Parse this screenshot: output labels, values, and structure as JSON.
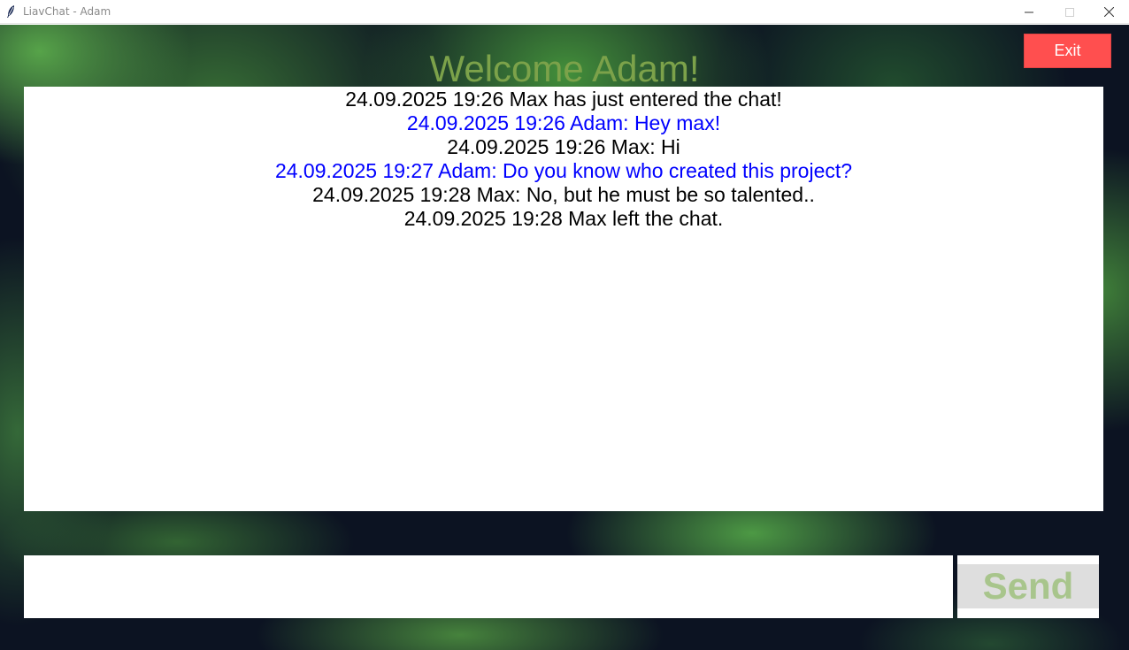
{
  "window": {
    "title": "LiavChat - Adam",
    "icon": "feather-icon",
    "controls": [
      "minimize-icon",
      "maximize-icon",
      "close-icon"
    ]
  },
  "header": {
    "welcome_text": "Welcome Adam!",
    "exit_label": "Exit"
  },
  "chat": {
    "messages": [
      {
        "text": "24.09.2025 19:26 Max has just entered the chat!",
        "from_self": false
      },
      {
        "text": "24.09.2025 19:26 Adam: Hey max!",
        "from_self": true
      },
      {
        "text": "24.09.2025 19:26 Max: Hi",
        "from_self": false
      },
      {
        "text": "24.09.2025 19:27 Adam: Do you know who created this project?",
        "from_self": true
      },
      {
        "text": "24.09.2025 19:28 Max: No, but he must be so talented..",
        "from_self": false
      },
      {
        "text": "24.09.2025 19:28 Max left the chat.",
        "from_self": false
      }
    ]
  },
  "composer": {
    "input_value": "",
    "send_label": "Send"
  },
  "colors": {
    "welcome": "#7ca24a",
    "exit_button": "#ff4f4f",
    "self_message": "#0000ff",
    "other_message": "#000000",
    "send_text": "#a8c58c",
    "background": "#0c1322"
  }
}
